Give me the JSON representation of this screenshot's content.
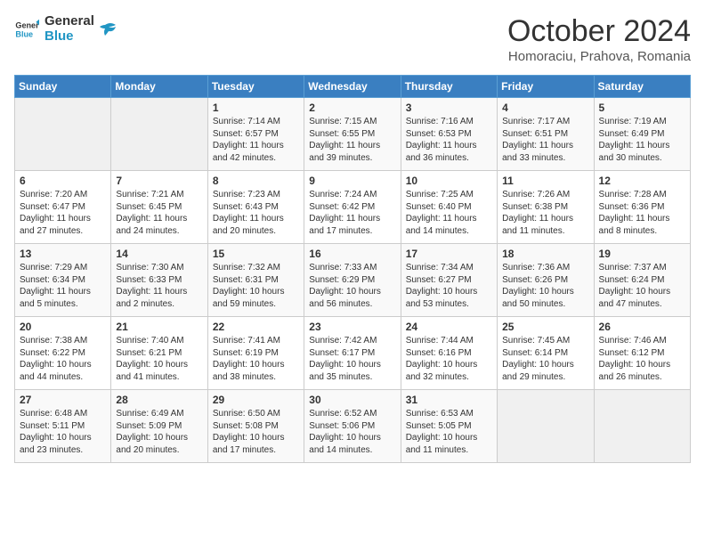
{
  "logo": {
    "line1": "General",
    "line2": "Blue"
  },
  "title": "October 2024",
  "subtitle": "Homoraciu, Prahova, Romania",
  "days_of_week": [
    "Sunday",
    "Monday",
    "Tuesday",
    "Wednesday",
    "Thursday",
    "Friday",
    "Saturday"
  ],
  "weeks": [
    [
      {
        "day": "",
        "text": ""
      },
      {
        "day": "",
        "text": ""
      },
      {
        "day": "1",
        "text": "Sunrise: 7:14 AM\nSunset: 6:57 PM\nDaylight: 11 hours and 42 minutes."
      },
      {
        "day": "2",
        "text": "Sunrise: 7:15 AM\nSunset: 6:55 PM\nDaylight: 11 hours and 39 minutes."
      },
      {
        "day": "3",
        "text": "Sunrise: 7:16 AM\nSunset: 6:53 PM\nDaylight: 11 hours and 36 minutes."
      },
      {
        "day": "4",
        "text": "Sunrise: 7:17 AM\nSunset: 6:51 PM\nDaylight: 11 hours and 33 minutes."
      },
      {
        "day": "5",
        "text": "Sunrise: 7:19 AM\nSunset: 6:49 PM\nDaylight: 11 hours and 30 minutes."
      }
    ],
    [
      {
        "day": "6",
        "text": "Sunrise: 7:20 AM\nSunset: 6:47 PM\nDaylight: 11 hours and 27 minutes."
      },
      {
        "day": "7",
        "text": "Sunrise: 7:21 AM\nSunset: 6:45 PM\nDaylight: 11 hours and 24 minutes."
      },
      {
        "day": "8",
        "text": "Sunrise: 7:23 AM\nSunset: 6:43 PM\nDaylight: 11 hours and 20 minutes."
      },
      {
        "day": "9",
        "text": "Sunrise: 7:24 AM\nSunset: 6:42 PM\nDaylight: 11 hours and 17 minutes."
      },
      {
        "day": "10",
        "text": "Sunrise: 7:25 AM\nSunset: 6:40 PM\nDaylight: 11 hours and 14 minutes."
      },
      {
        "day": "11",
        "text": "Sunrise: 7:26 AM\nSunset: 6:38 PM\nDaylight: 11 hours and 11 minutes."
      },
      {
        "day": "12",
        "text": "Sunrise: 7:28 AM\nSunset: 6:36 PM\nDaylight: 11 hours and 8 minutes."
      }
    ],
    [
      {
        "day": "13",
        "text": "Sunrise: 7:29 AM\nSunset: 6:34 PM\nDaylight: 11 hours and 5 minutes."
      },
      {
        "day": "14",
        "text": "Sunrise: 7:30 AM\nSunset: 6:33 PM\nDaylight: 11 hours and 2 minutes."
      },
      {
        "day": "15",
        "text": "Sunrise: 7:32 AM\nSunset: 6:31 PM\nDaylight: 10 hours and 59 minutes."
      },
      {
        "day": "16",
        "text": "Sunrise: 7:33 AM\nSunset: 6:29 PM\nDaylight: 10 hours and 56 minutes."
      },
      {
        "day": "17",
        "text": "Sunrise: 7:34 AM\nSunset: 6:27 PM\nDaylight: 10 hours and 53 minutes."
      },
      {
        "day": "18",
        "text": "Sunrise: 7:36 AM\nSunset: 6:26 PM\nDaylight: 10 hours and 50 minutes."
      },
      {
        "day": "19",
        "text": "Sunrise: 7:37 AM\nSunset: 6:24 PM\nDaylight: 10 hours and 47 minutes."
      }
    ],
    [
      {
        "day": "20",
        "text": "Sunrise: 7:38 AM\nSunset: 6:22 PM\nDaylight: 10 hours and 44 minutes."
      },
      {
        "day": "21",
        "text": "Sunrise: 7:40 AM\nSunset: 6:21 PM\nDaylight: 10 hours and 41 minutes."
      },
      {
        "day": "22",
        "text": "Sunrise: 7:41 AM\nSunset: 6:19 PM\nDaylight: 10 hours and 38 minutes."
      },
      {
        "day": "23",
        "text": "Sunrise: 7:42 AM\nSunset: 6:17 PM\nDaylight: 10 hours and 35 minutes."
      },
      {
        "day": "24",
        "text": "Sunrise: 7:44 AM\nSunset: 6:16 PM\nDaylight: 10 hours and 32 minutes."
      },
      {
        "day": "25",
        "text": "Sunrise: 7:45 AM\nSunset: 6:14 PM\nDaylight: 10 hours and 29 minutes."
      },
      {
        "day": "26",
        "text": "Sunrise: 7:46 AM\nSunset: 6:12 PM\nDaylight: 10 hours and 26 minutes."
      }
    ],
    [
      {
        "day": "27",
        "text": "Sunrise: 6:48 AM\nSunset: 5:11 PM\nDaylight: 10 hours and 23 minutes."
      },
      {
        "day": "28",
        "text": "Sunrise: 6:49 AM\nSunset: 5:09 PM\nDaylight: 10 hours and 20 minutes."
      },
      {
        "day": "29",
        "text": "Sunrise: 6:50 AM\nSunset: 5:08 PM\nDaylight: 10 hours and 17 minutes."
      },
      {
        "day": "30",
        "text": "Sunrise: 6:52 AM\nSunset: 5:06 PM\nDaylight: 10 hours and 14 minutes."
      },
      {
        "day": "31",
        "text": "Sunrise: 6:53 AM\nSunset: 5:05 PM\nDaylight: 10 hours and 11 minutes."
      },
      {
        "day": "",
        "text": ""
      },
      {
        "day": "",
        "text": ""
      }
    ]
  ]
}
